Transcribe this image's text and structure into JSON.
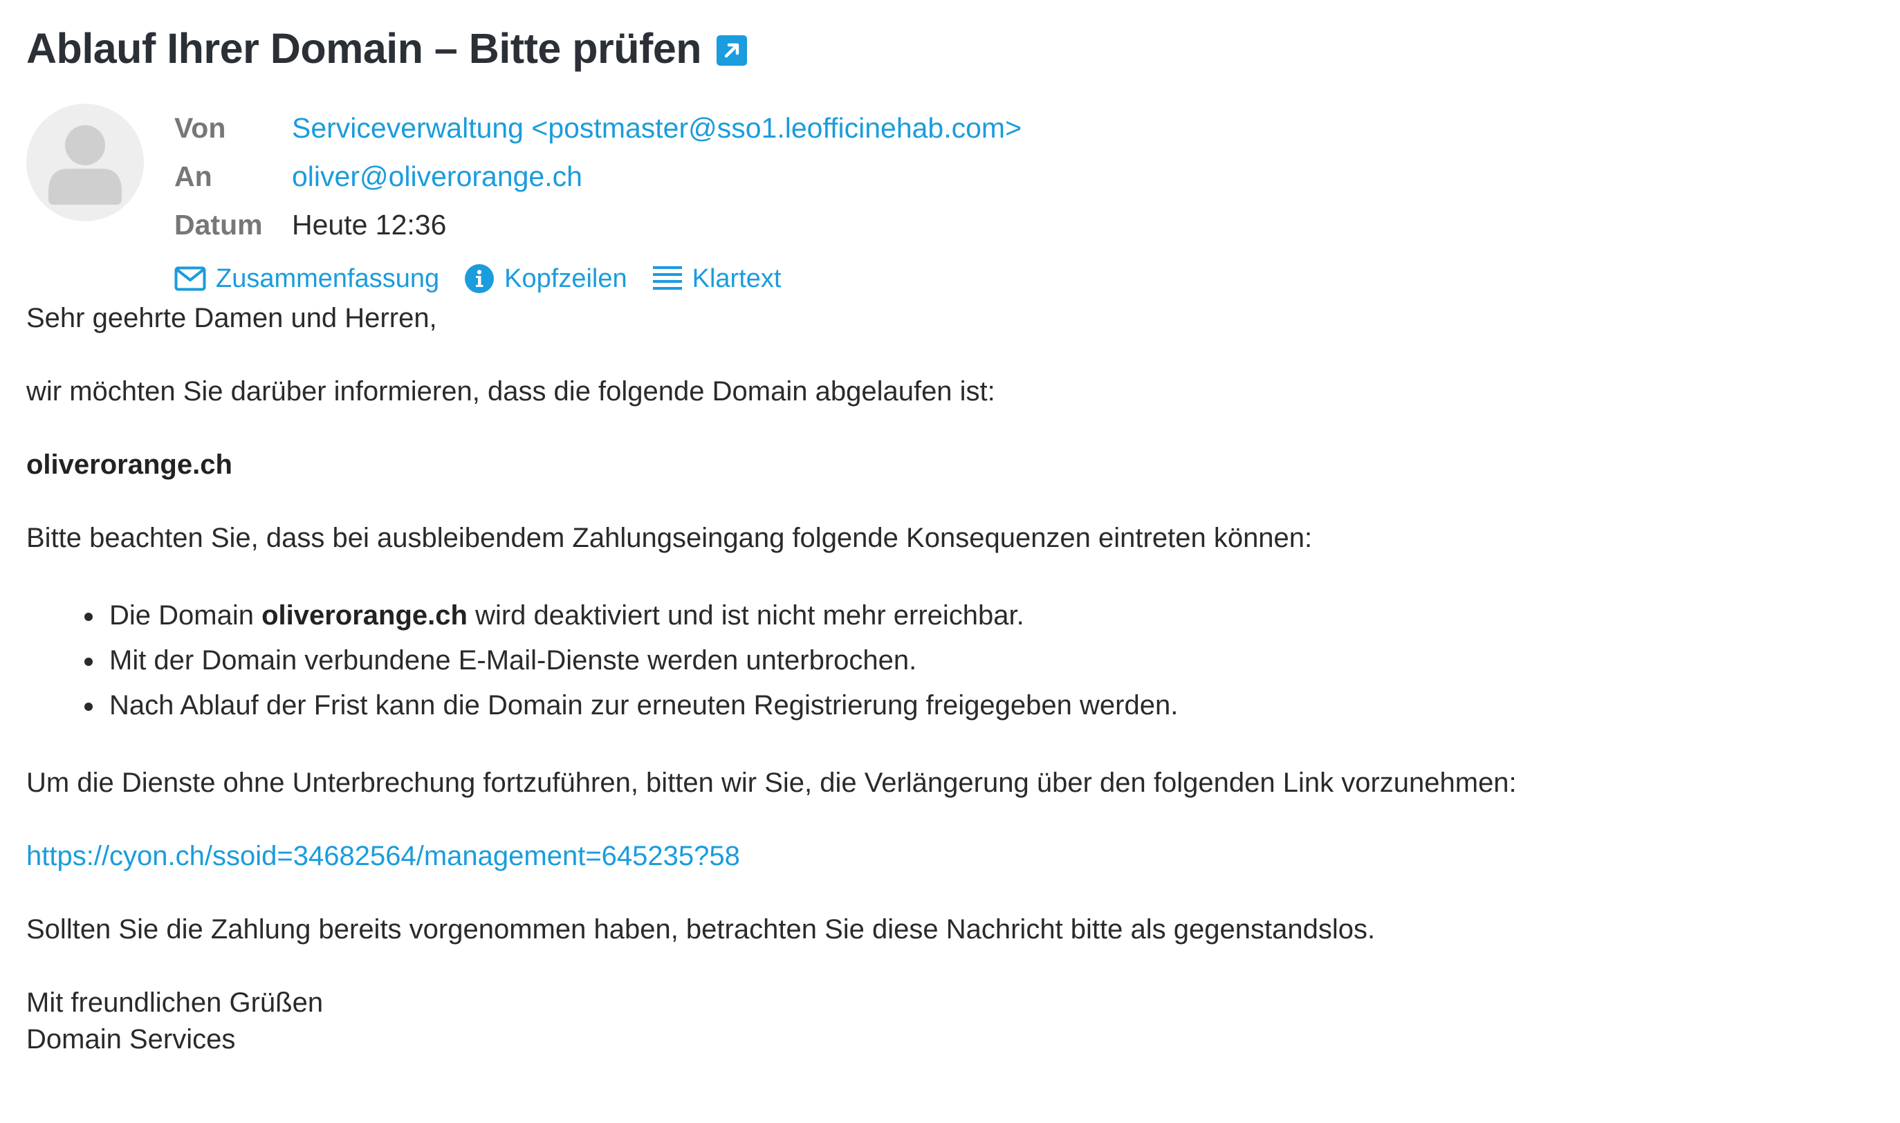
{
  "message": {
    "subject": "Ablauf Ihrer Domain – Bitte prüfen",
    "popout_icon": "external-link-icon"
  },
  "headers": {
    "from_label": "Von",
    "from_value": "Serviceverwaltung <postmaster@sso1.leofficinehab.com>",
    "to_label": "An",
    "to_value": "oliver@oliverorange.ch",
    "date_label": "Datum",
    "date_value": "Heute 12:36",
    "avatar_icon": "person-icon"
  },
  "view_tabs": [
    {
      "label": "Zusammenfassung",
      "icon": "envelope-icon"
    },
    {
      "label": "Kopfzeilen",
      "icon": "info-icon"
    },
    {
      "label": "Klartext",
      "icon": "list-icon"
    }
  ],
  "body": {
    "greeting": "Sehr geehrte Damen und Herren,",
    "intro": "wir möchten Sie darüber informieren, dass die folgende Domain abgelaufen ist:",
    "domain": "oliverorange.ch",
    "consequences_intro": "Bitte beachten Sie, dass bei ausbleibendem Zahlungseingang folgende Konsequenzen eintreten können:",
    "bullets": [
      {
        "before": "Die Domain ",
        "bold": "oliverorange.ch",
        "after": " wird deaktiviert und ist nicht mehr erreichbar."
      },
      {
        "text": "Mit der Domain verbundene E-Mail-Dienste werden unterbrochen."
      },
      {
        "text": "Nach Ablauf der Frist kann die Domain zur erneuten Registrierung freigegeben werden."
      }
    ],
    "renew_request": "Um die Dienste ohne Unterbrechung fortzuführen, bitten wir Sie, die Verlängerung über den folgenden Link vorzunehmen:",
    "link": "https://cyon.ch/ssoid=34682564/management=645235?58",
    "disclaimer": "Sollten Sie die Zahlung bereits vorgenommen haben, betrachten Sie diese Nachricht bitte als gegenstandslos.",
    "closing": "Mit freundlichen Grüßen",
    "signature": "Domain Services"
  },
  "colors": {
    "accent": "#1a9cdd",
    "label_gray": "#777777",
    "avatar_bg": "#eeeeee",
    "avatar_fg": "#cfcfcf"
  }
}
